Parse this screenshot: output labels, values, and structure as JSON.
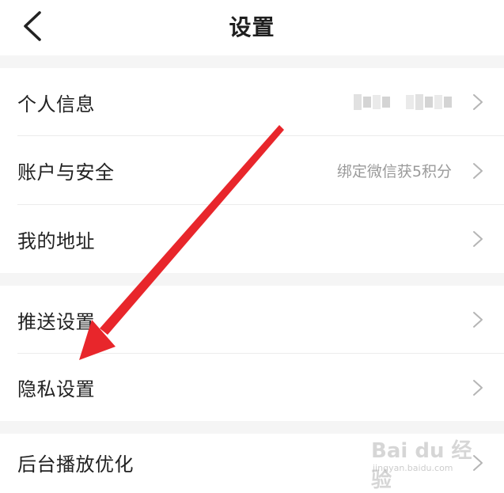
{
  "header": {
    "title": "设置",
    "back_icon": "chevron-left-icon"
  },
  "sections": [
    {
      "items": [
        {
          "label": "个人信息",
          "value": "",
          "value_redacted": true
        },
        {
          "label": "账户与安全",
          "value": "绑定微信获5积分"
        },
        {
          "label": "我的地址",
          "value": ""
        }
      ]
    },
    {
      "items": [
        {
          "label": "推送设置",
          "value": ""
        },
        {
          "label": "隐私设置",
          "value": ""
        }
      ]
    },
    {
      "items": [
        {
          "label": "后台播放优化",
          "value": ""
        }
      ]
    }
  ],
  "annotation": {
    "type": "arrow",
    "color": "#e8262b",
    "points_to": "隐私设置"
  },
  "watermark": {
    "logo_text": "Bai du 经验",
    "url": "jingyan.baidu.com"
  },
  "colors": {
    "background": "#ffffff",
    "section_gap": "#f5f5f5",
    "text_primary": "#222222",
    "text_secondary": "#9a9a9a",
    "divider": "#ececec",
    "chevron": "#b5b5b5"
  }
}
